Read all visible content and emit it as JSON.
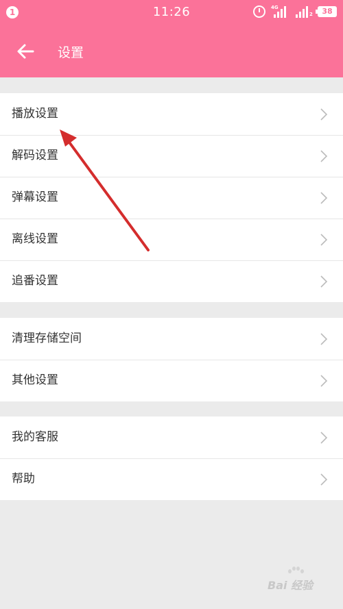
{
  "status_bar": {
    "notification_count": "1",
    "time": "11:26",
    "network_label": "4G",
    "sim2_label": "2",
    "battery": "38",
    "icons": [
      "alarm-icon",
      "signal-icon",
      "battery-icon"
    ]
  },
  "app_bar": {
    "back_icon": "arrow-left-icon",
    "title": "设置"
  },
  "groups": [
    [
      {
        "label": "播放设置",
        "icon": "chevron-right-icon"
      },
      {
        "label": "解码设置",
        "icon": "chevron-right-icon"
      },
      {
        "label": "弹幕设置",
        "icon": "chevron-right-icon"
      },
      {
        "label": "离线设置",
        "icon": "chevron-right-icon"
      },
      {
        "label": "追番设置",
        "icon": "chevron-right-icon"
      }
    ],
    [
      {
        "label": "清理存储空间",
        "icon": "chevron-right-icon"
      },
      {
        "label": "其他设置",
        "icon": "chevron-right-icon"
      }
    ],
    [
      {
        "label": "我的客服",
        "icon": "chevron-right-icon"
      },
      {
        "label": "帮助",
        "icon": "chevron-right-icon"
      }
    ]
  ],
  "watermark": {
    "text": "Bai 经验"
  },
  "colors": {
    "accent": "#fb7299",
    "background": "#ebebeb",
    "annotation_arrow": "#d42d2d",
    "divider": "#e6e6e6",
    "chevron": "#bbbbbb"
  }
}
